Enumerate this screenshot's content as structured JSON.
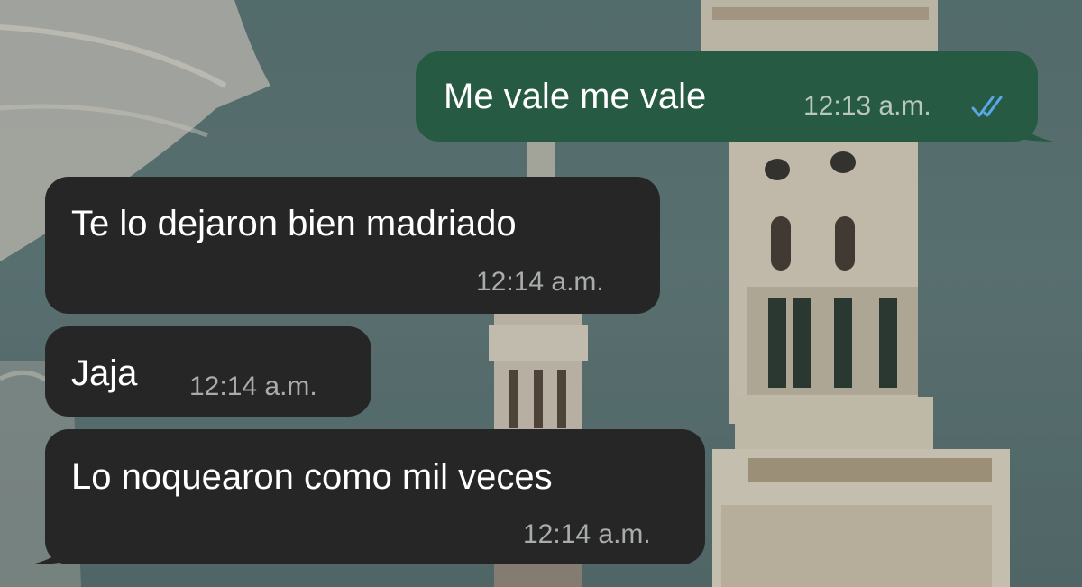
{
  "messages": [
    {
      "direction": "outgoing",
      "text": "Me vale me vale",
      "time": "12:13 a.m.",
      "status": "read-double-check-icon",
      "status_color": "#5aa7e6"
    },
    {
      "direction": "incoming",
      "text": "Te lo dejaron bien madriado",
      "time": "12:14 a.m."
    },
    {
      "direction": "incoming",
      "text": "Jaja",
      "time": "12:14 a.m."
    },
    {
      "direction": "incoming",
      "text": "Lo noquearon como mil veces",
      "time": "12:14 a.m."
    }
  ],
  "colors": {
    "outgoing_bubble": "#265a43",
    "incoming_bubble": "#262626",
    "wallpaper_sky": "#627c7c"
  }
}
